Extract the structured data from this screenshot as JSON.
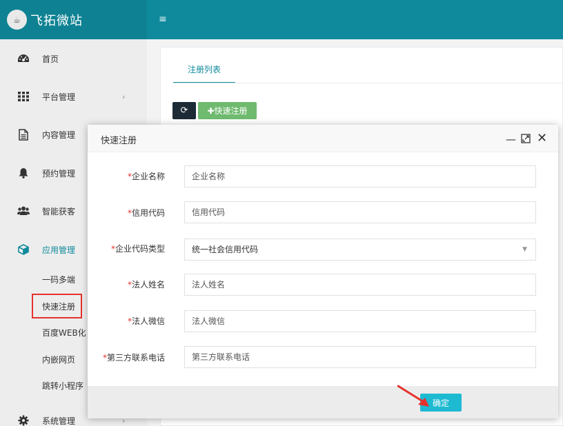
{
  "header": {
    "logo_glyph": "☕",
    "title": "飞拓微站",
    "menu_toggle_glyph": "≡"
  },
  "sidebar": {
    "items": [
      {
        "label": "首页",
        "icon": "dashboard-icon"
      },
      {
        "label": "平台管理",
        "icon": "grid-icon",
        "arrow": "›"
      },
      {
        "label": "内容管理",
        "icon": "document-icon"
      },
      {
        "label": "预约管理",
        "icon": "bell-icon"
      },
      {
        "label": "智能获客",
        "icon": "users-icon"
      },
      {
        "label": "应用管理",
        "icon": "cube-icon",
        "active": true
      },
      {
        "label": "系统管理",
        "icon": "gear-icon",
        "arrow": "›"
      }
    ],
    "sub_items": [
      "一码多端",
      "快速注册",
      "百度WEB化",
      "内嵌网页",
      "跳转小程序"
    ],
    "highlighted_sub_item": "快速注册"
  },
  "content": {
    "tab_label": "注册列表",
    "refresh_glyph": "⟳",
    "quick_register_label": "✚快速注册"
  },
  "dialog": {
    "title": "快速注册",
    "min_glyph": "—",
    "close_glyph": "✕",
    "required_mark": "*",
    "fields": [
      {
        "label": "企业名称",
        "placeholder": "企业名称"
      },
      {
        "label": "信用代码",
        "placeholder": "信用代码"
      },
      {
        "label": "企业代码类型",
        "value": "统一社会信用代码",
        "caret": "▼"
      },
      {
        "label": "法人姓名",
        "placeholder": "法人姓名"
      },
      {
        "label": "法人微信",
        "placeholder": "法人微信"
      },
      {
        "label": "第三方联系电话",
        "placeholder": "第三方联系电话"
      }
    ],
    "confirm_label": "确定"
  },
  "colors": {
    "header": "#0f8a9c",
    "accent": "#0f8a9c",
    "confirm": "#1ebad2",
    "quick_register": "#6fba6f",
    "highlight_box": "#e5322d"
  }
}
